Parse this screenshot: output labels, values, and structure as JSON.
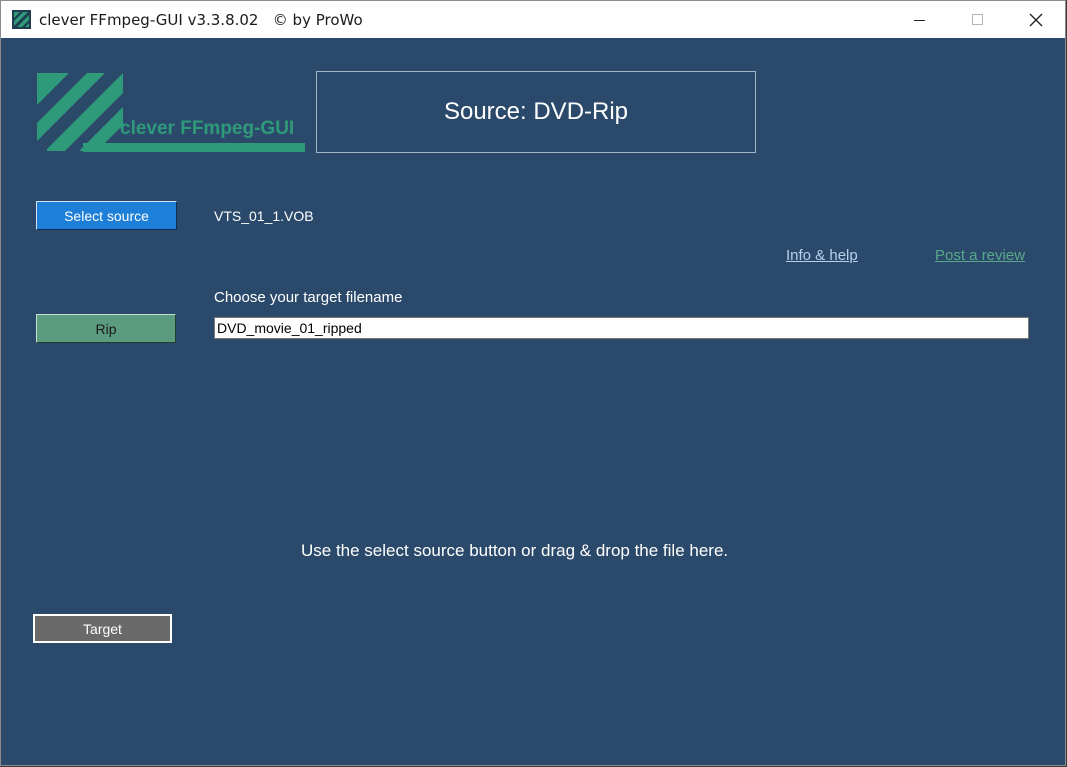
{
  "window": {
    "title": "clever FFmpeg-GUI v3.3.8.02   © by ProWo"
  },
  "logo": {
    "text": "clever FFmpeg-GUI",
    "color": "#2f9a7a"
  },
  "header": {
    "source_title": "Source: DVD-Rip"
  },
  "source": {
    "select_button_label": "Select source",
    "filename": "VTS_01_1.VOB"
  },
  "links": {
    "info_help": "Info & help",
    "post_review": "Post a review"
  },
  "target": {
    "label": "Choose your target filename",
    "value": "DVD_movie_01_ripped",
    "button_label": "Target"
  },
  "rip": {
    "button_label": "Rip"
  },
  "hint": "Use the select source button or drag & drop the file here.",
  "colors": {
    "background": "#2b4a6b",
    "select_button": "#1e7fd8",
    "rip_button": "#5b9b7f",
    "target_button": "#6a6a6a"
  }
}
